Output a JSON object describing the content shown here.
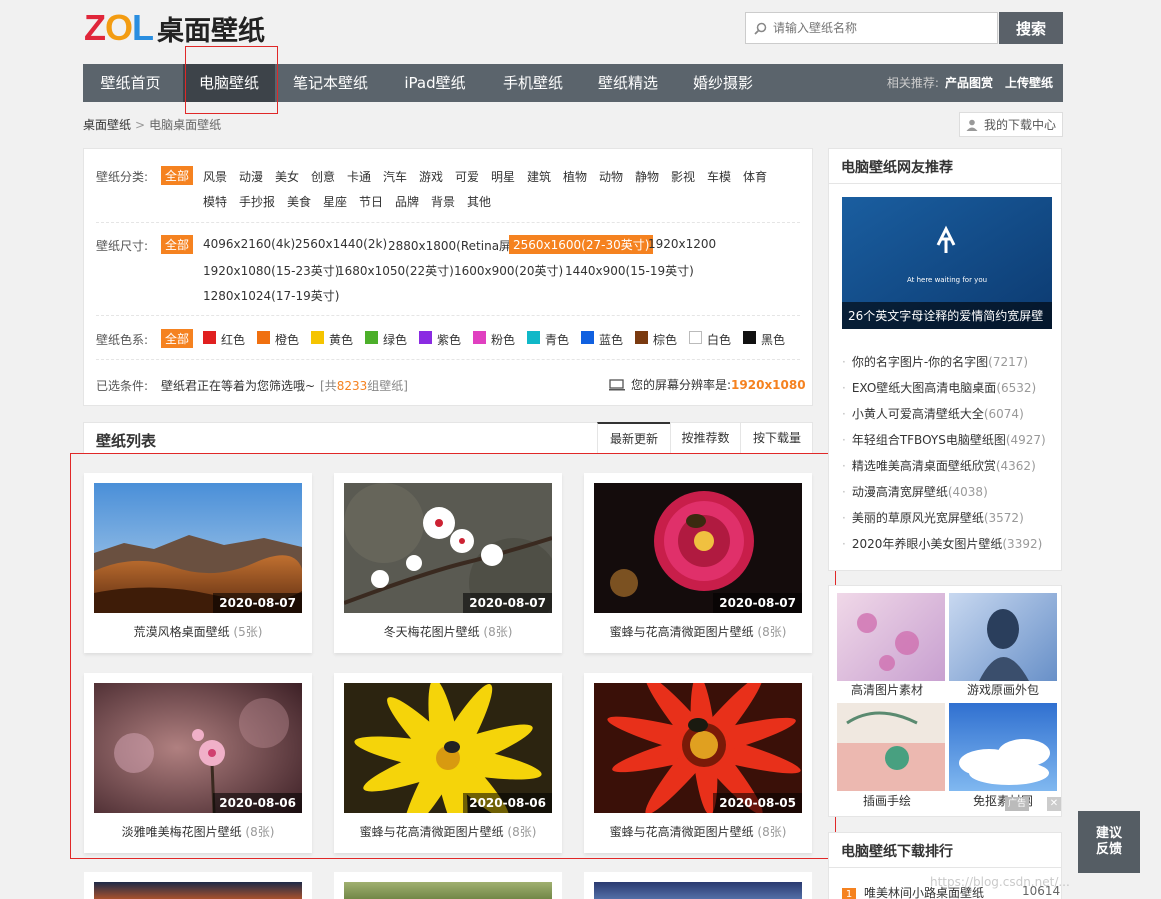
{
  "header": {
    "logo_brand": "ZOL",
    "logo_text": "桌面壁纸",
    "search_placeholder": "请输入壁纸名称",
    "search_button": "搜索"
  },
  "nav": {
    "items": [
      "壁纸首页",
      "电脑壁纸",
      "笔记本壁纸",
      "iPad壁纸",
      "手机壁纸",
      "壁纸精选",
      "婚纱摄影"
    ],
    "active_index": 1,
    "related_label": "相关推荐:",
    "related_link": "产品图赏",
    "upload_link": "上传壁纸"
  },
  "breadcrumb": {
    "home": "桌面壁纸",
    "separator": ">",
    "current": "电脑桌面壁纸"
  },
  "my_downloads": "我的下载中心",
  "filter": {
    "category_label": "壁纸分类:",
    "categories": [
      "全部",
      "风景",
      "动漫",
      "美女",
      "创意",
      "卡通",
      "汽车",
      "游戏",
      "可爱",
      "明星",
      "建筑",
      "植物",
      "动物",
      "静物",
      "影视",
      "车模",
      "体育",
      "模特",
      "手抄报",
      "美食",
      "星座",
      "节日",
      "品牌",
      "背景",
      "其他"
    ],
    "size_label": "壁纸尺寸:",
    "sizes": [
      "全部",
      "4096x2160(4k)",
      "2560x1440(2k)",
      "2880x1800(Retina屏)",
      "2560x1600(27-30英寸)",
      "1920x1200",
      "1920x1080(15-23英寸)",
      "1680x1050(22英寸)",
      "1600x900(20英寸)",
      "1440x900(15-19英寸)",
      "1280x1024(17-19英寸)"
    ],
    "color_label": "壁纸色系:",
    "colors": [
      {
        "name": "全部",
        "hex": ""
      },
      {
        "name": "红色",
        "hex": "#e02020"
      },
      {
        "name": "橙色",
        "hex": "#f07010"
      },
      {
        "name": "黄色",
        "hex": "#f5c400"
      },
      {
        "name": "绿色",
        "hex": "#4caf2a"
      },
      {
        "name": "紫色",
        "hex": "#8a2be2"
      },
      {
        "name": "粉色",
        "hex": "#e040c0"
      },
      {
        "name": "青色",
        "hex": "#10b8c8"
      },
      {
        "name": "蓝色",
        "hex": "#1060e0"
      },
      {
        "name": "棕色",
        "hex": "#7a3a10"
      },
      {
        "name": "白色",
        "hex": "#ffffff"
      },
      {
        "name": "黑色",
        "hex": "#111111"
      }
    ],
    "selected_label": "已选条件:",
    "selected_text": "壁纸君正在等着为您筛选哦~",
    "count_prefix": "[共",
    "count": "8233",
    "count_suffix": "组壁纸]",
    "resolution_label": "您的屏幕分辨率是:",
    "resolution": "1920x1080"
  },
  "list": {
    "title": "壁纸列表",
    "tabs": [
      "最新更新",
      "按推荐数",
      "按下载量"
    ],
    "cards": [
      {
        "title": "荒漠风格桌面壁纸",
        "count": "(5张)",
        "date": "2020-08-07"
      },
      {
        "title": "冬天梅花图片壁纸",
        "count": "(8张)",
        "date": "2020-08-07"
      },
      {
        "title": "蜜蜂与花高清微距图片壁纸",
        "count": "(8张)",
        "date": "2020-08-07"
      },
      {
        "title": "淡雅唯美梅花图片壁纸",
        "count": "(8张)",
        "date": "2020-08-06"
      },
      {
        "title": "蜜蜂与花高清微距图片壁纸",
        "count": "(8张)",
        "date": "2020-08-06"
      },
      {
        "title": "蜜蜂与花高清微距图片壁纸",
        "count": "(8张)",
        "date": "2020-08-05"
      }
    ]
  },
  "sidebar": {
    "title": "电脑壁纸网友推荐",
    "featured_caption": "26个英文字母诠释的爱情简约宽屏壁",
    "featured_text": "At here waiting for you",
    "items": [
      {
        "text": "你的名字图片-你的名字图",
        "count": "(7217)"
      },
      {
        "text": "EXO壁纸大图高清电脑桌面",
        "count": "(6532)"
      },
      {
        "text": "小黄人可爱高清壁纸大全",
        "count": "(6074)"
      },
      {
        "text": "年轻组合TFBOYS电脑壁纸图",
        "count": "(4927)"
      },
      {
        "text": "精选唯美高清桌面壁纸欣赏",
        "count": "(4362)"
      },
      {
        "text": "动漫高清宽屏壁纸",
        "count": "(4038)"
      },
      {
        "text": "美丽的草原风光宽屏壁纸",
        "count": "(3572)"
      },
      {
        "text": "2020年养眼小美女图片壁纸",
        "count": "(3392)"
      }
    ],
    "ads": [
      "高清图片素材",
      "游戏原画外包",
      "插画手绘",
      "免抠素材网"
    ],
    "ad_tag": "广告",
    "rank_title": "电脑壁纸下载排行",
    "rank_first": {
      "num": "1",
      "text": "唯美林间小路桌面壁纸",
      "count": "10614"
    }
  },
  "feedback": "建议反馈",
  "watermark": "https://blog.csdn.net/..."
}
